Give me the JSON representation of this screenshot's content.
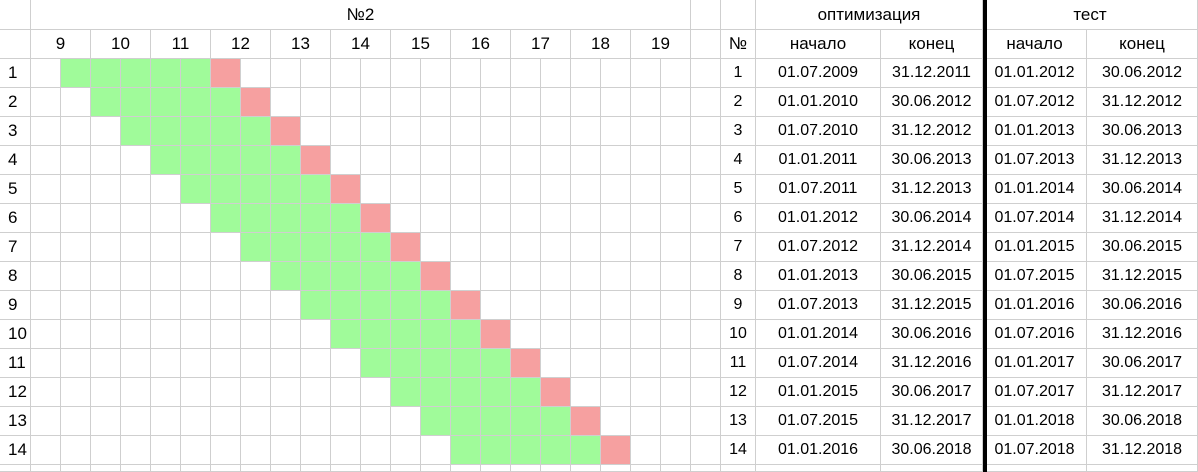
{
  "left_panel": {
    "title": "№2",
    "columns": [
      "9",
      "10",
      "11",
      "12",
      "13",
      "14",
      "15",
      "16",
      "17",
      "18",
      "19"
    ],
    "rows": [
      "1",
      "2",
      "3",
      "4",
      "5",
      "6",
      "7",
      "8",
      "9",
      "10",
      "11",
      "12",
      "13",
      "14"
    ],
    "color_green": "#a0fb9a",
    "color_red": "#f6a0a0"
  },
  "right_table": {
    "group_optimization": "оптимизация",
    "group_test": "тест",
    "col_no": "№",
    "col_start": "начало",
    "col_end": "конец",
    "rows": [
      {
        "n": "1",
        "opt_start": "01.07.2009",
        "opt_end": "31.12.2011",
        "test_start": "01.01.2012",
        "test_end": "30.06.2012"
      },
      {
        "n": "2",
        "opt_start": "01.01.2010",
        "opt_end": "30.06.2012",
        "test_start": "01.07.2012",
        "test_end": "31.12.2012"
      },
      {
        "n": "3",
        "opt_start": "01.07.2010",
        "opt_end": "31.12.2012",
        "test_start": "01.01.2013",
        "test_end": "30.06.2013"
      },
      {
        "n": "4",
        "opt_start": "01.01.2011",
        "opt_end": "30.06.2013",
        "test_start": "01.07.2013",
        "test_end": "31.12.2013"
      },
      {
        "n": "5",
        "opt_start": "01.07.2011",
        "opt_end": "31.12.2013",
        "test_start": "01.01.2014",
        "test_end": "30.06.2014"
      },
      {
        "n": "6",
        "opt_start": "01.01.2012",
        "opt_end": "30.06.2014",
        "test_start": "01.07.2014",
        "test_end": "31.12.2014"
      },
      {
        "n": "7",
        "opt_start": "01.07.2012",
        "opt_end": "31.12.2014",
        "test_start": "01.01.2015",
        "test_end": "30.06.2015"
      },
      {
        "n": "8",
        "opt_start": "01.01.2013",
        "opt_end": "30.06.2015",
        "test_start": "01.07.2015",
        "test_end": "31.12.2015"
      },
      {
        "n": "9",
        "opt_start": "01.07.2013",
        "opt_end": "31.12.2015",
        "test_start": "01.01.2016",
        "test_end": "30.06.2016"
      },
      {
        "n": "10",
        "opt_start": "01.01.2014",
        "opt_end": "30.06.2016",
        "test_start": "01.07.2016",
        "test_end": "31.12.2016"
      },
      {
        "n": "11",
        "opt_start": "01.07.2014",
        "opt_end": "31.12.2016",
        "test_start": "01.01.2017",
        "test_end": "30.06.2017"
      },
      {
        "n": "12",
        "opt_start": "01.01.2015",
        "opt_end": "30.06.2017",
        "test_start": "01.07.2017",
        "test_end": "31.12.2017"
      },
      {
        "n": "13",
        "opt_start": "01.07.2015",
        "opt_end": "31.12.2017",
        "test_start": "01.01.2018",
        "test_end": "30.06.2018"
      },
      {
        "n": "14",
        "opt_start": "01.01.2016",
        "opt_end": "30.06.2018",
        "test_start": "01.07.2018",
        "test_end": "31.12.2018"
      }
    ]
  }
}
